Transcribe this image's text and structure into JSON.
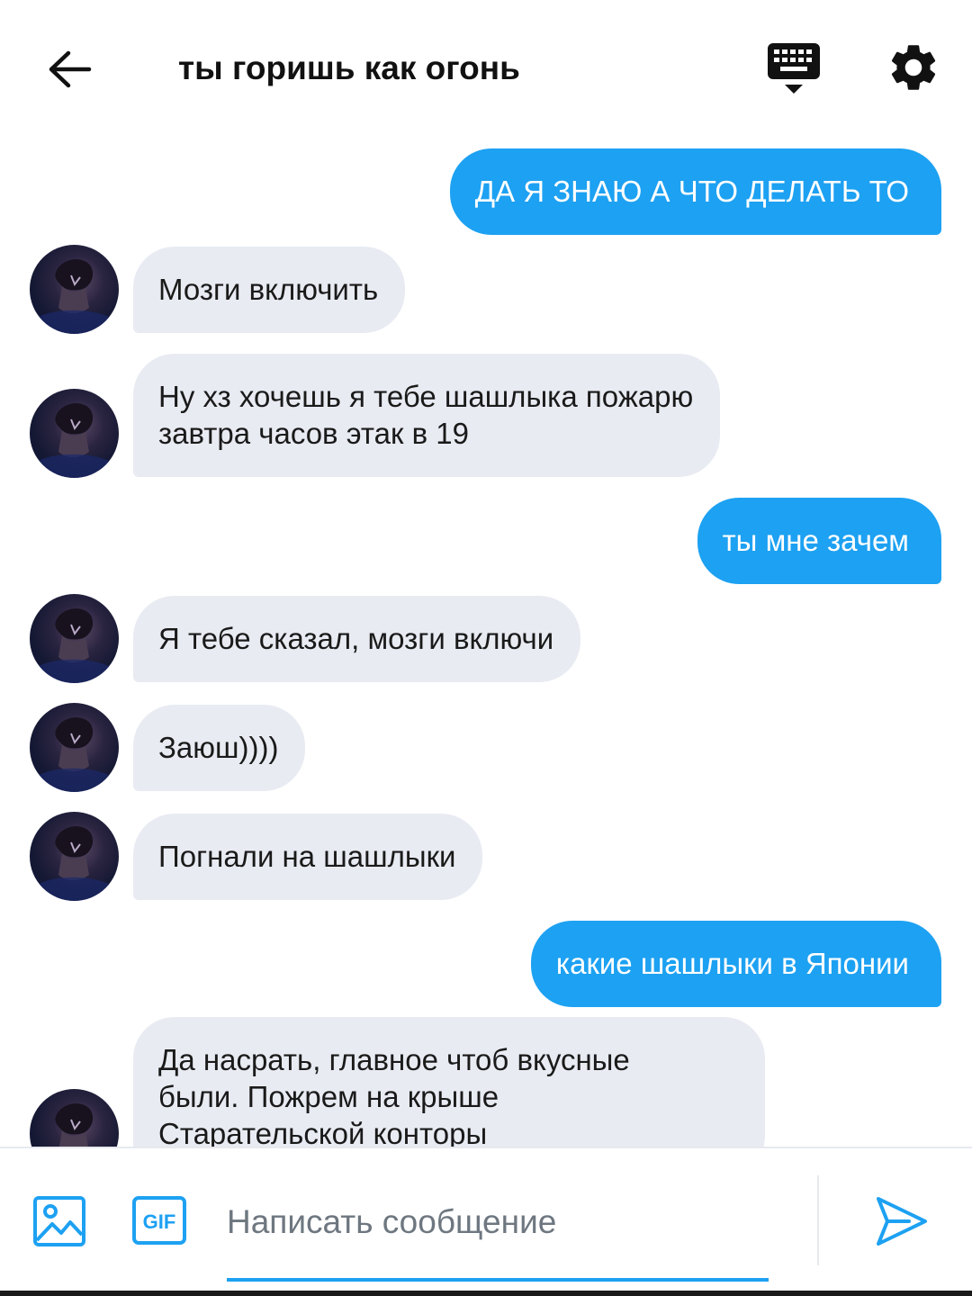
{
  "header": {
    "title": "ты горишь как огонь",
    "back_icon": "arrow-left-icon",
    "keyboard_icon": "keyboard-icon",
    "settings_icon": "gear-icon"
  },
  "messages": [
    {
      "direction": "out",
      "text": "ДА Я ЗНАЮ А ЧТО ДЕЛАТЬ ТО"
    },
    {
      "direction": "in",
      "text": "Мозги включить"
    },
    {
      "direction": "in",
      "text": "Ну хз хочешь я тебе шашлыка пожарю\nзавтра часов этак в 19"
    },
    {
      "direction": "out",
      "text": "ты мне зачем"
    },
    {
      "direction": "in",
      "text": "Я тебе сказал, мозги включи"
    },
    {
      "direction": "in",
      "text": "Заюш))))"
    },
    {
      "direction": "in",
      "text": "Погнали на шашлыки"
    },
    {
      "direction": "out",
      "text": "какие шашлыки в Японии"
    },
    {
      "direction": "in",
      "text": "Да насрать, главное чтоб вкусные\nбыли. Пожрем на крыше\nСтарательской конторы"
    }
  ],
  "composer": {
    "placeholder": "Написать сообщение",
    "value": "",
    "gif_label": "GIF",
    "image_icon": "image-icon",
    "send_icon": "send-icon"
  },
  "colors": {
    "accent": "#1da1f2",
    "incoming_bubble": "#e8ebf2",
    "text": "#1a1a1a"
  }
}
